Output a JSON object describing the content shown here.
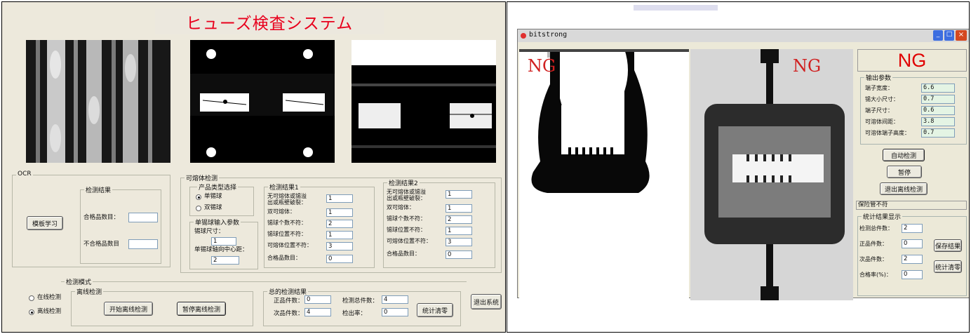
{
  "left": {
    "title": "ヒューズ検査システム",
    "ocr": {
      "group": "OCR",
      "learn_button": "模板学习",
      "result_group": "检测结果",
      "pass_label": "合格品数目：",
      "pass_value": "",
      "fail_label": "不合格品数目",
      "fail_value": ""
    },
    "fusible": {
      "group": "可熔体检测",
      "product_group": "产品类型选择",
      "single_ball": "单锡球",
      "double_ball": "双锡球",
      "single_ball_selected": true,
      "params_group": "单锡球输入参数",
      "size_label": "锡球尺寸：",
      "size_value": "1",
      "center_label": "单锡球轴向中心距：",
      "center_value": "2"
    },
    "result1": {
      "group": "检测结果1",
      "rows": [
        {
          "label": "无可熔体或锡溢\n出或瓶壁破裂：",
          "value": "1"
        },
        {
          "label": "双可熔体：",
          "value": "1"
        },
        {
          "label": "锡球个数不符：",
          "value": "2"
        },
        {
          "label": "锡球位置不符：",
          "value": "1"
        },
        {
          "label": "可熔体位置不符：",
          "value": "3"
        },
        {
          "label": "合格品数目：",
          "value": "0"
        }
      ]
    },
    "result2": {
      "group": "检测结果2",
      "rows": [
        {
          "label": "无可熔体或锡溢\n出或瓶壁破裂：",
          "value": "1"
        },
        {
          "label": "双可熔体：",
          "value": "1"
        },
        {
          "label": "锡球个数不符：",
          "value": "2"
        },
        {
          "label": "锡球位置不符：",
          "value": "1"
        },
        {
          "label": "可熔体位置不符：",
          "value": "3"
        },
        {
          "label": "合格品数目：",
          "value": "0"
        }
      ]
    },
    "mode": {
      "group": "检测模式",
      "online": "在线检测",
      "offline": "离线检测",
      "offline_selected": true,
      "offline_group": "离线检测",
      "start_button": "开始离线检测",
      "pause_button": "暂停离线检测"
    },
    "total": {
      "group": "总的检测结果",
      "good_label": "正品件数：",
      "good_value": "0",
      "bad_label": "次品件数：",
      "bad_value": "4",
      "total_label": "检测总件数：",
      "total_value": "4",
      "rate_label": "检出率：",
      "rate_value": "0",
      "clear_button": "统计清零"
    },
    "exit_button": "退出系统"
  },
  "right": {
    "window_title": "bitstrong",
    "ng_label_1": "NG",
    "ng_label_2": "NG",
    "result_display": "NG",
    "output_group": "输出参数",
    "params": [
      {
        "label": "端子宽度：",
        "value": "6.6"
      },
      {
        "label": "锡大小尺寸：",
        "value": "0.7"
      },
      {
        "label": "端子尺寸：",
        "value": "0.6"
      },
      {
        "label": "可溶体间距：",
        "value": "3.8"
      },
      {
        "label": "可溶体端子高度：",
        "value": "0.7"
      }
    ],
    "auto_button": "自动检测",
    "pause_button": "暂停",
    "exit_button": "退出离线检测",
    "status_text": "保险管不符",
    "stats_group": "统计结果显示",
    "stats": [
      {
        "label": "检测总件数：",
        "value": "2"
      },
      {
        "label": "正品件数：",
        "value": "0"
      },
      {
        "label": "次品件数：",
        "value": "2"
      },
      {
        "label": "合格率(%)：",
        "value": "0"
      }
    ],
    "save_button": "保存结果",
    "clear_button": "统计清零",
    "colors": {
      "titlebar": "#d9d9d9",
      "ng_red": "#e00000",
      "param_field": "#e4f4e4"
    }
  }
}
